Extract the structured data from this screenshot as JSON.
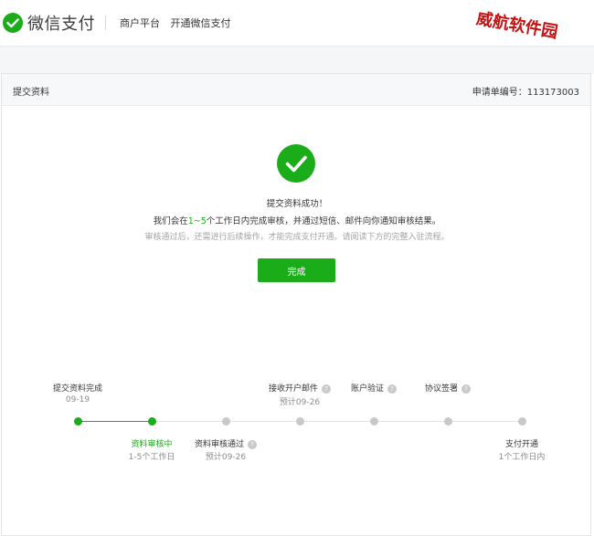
{
  "header": {
    "brand_name": "微信支付",
    "nav": [
      "商户平台",
      "开通微信支付"
    ]
  },
  "watermark": "威航软件园",
  "card": {
    "title": "提交资料",
    "application_no": "申请单编号：113173003"
  },
  "result": {
    "title": "提交资料成功！",
    "line2_before": "我们会在",
    "line2_highlight": "1~5",
    "line2_after": "个工作日内完成审核，并通过短信、邮件向你通知审核结果。",
    "line3": "审核通过后，还需进行后续操作，才能完成支付开通。请阅读下方的完整入驻流程。",
    "done_button": "完成"
  },
  "steps": [
    {
      "label": "提交资料完成",
      "sub": "09-19",
      "status": "done",
      "help": false
    },
    {
      "label": "资料审核中",
      "sub": "1-5个工作日",
      "status": "current",
      "help": false
    },
    {
      "label": "资料审核通过",
      "sub": "预计09-26",
      "status": "pending",
      "help": true
    },
    {
      "label": "接收开户邮件",
      "sub": "预计09-26",
      "status": "pending",
      "help": true
    },
    {
      "label": "账户验证",
      "sub": "",
      "status": "pending",
      "help": true
    },
    {
      "label": "协议签署",
      "sub": "",
      "status": "pending",
      "help": true
    },
    {
      "label": "支付开通",
      "sub": "1个工作日内",
      "status": "pending",
      "help": false
    }
  ],
  "colors": {
    "accent": "#1aad19",
    "pending": "#c8c8c8",
    "watermark": "#c31212"
  }
}
